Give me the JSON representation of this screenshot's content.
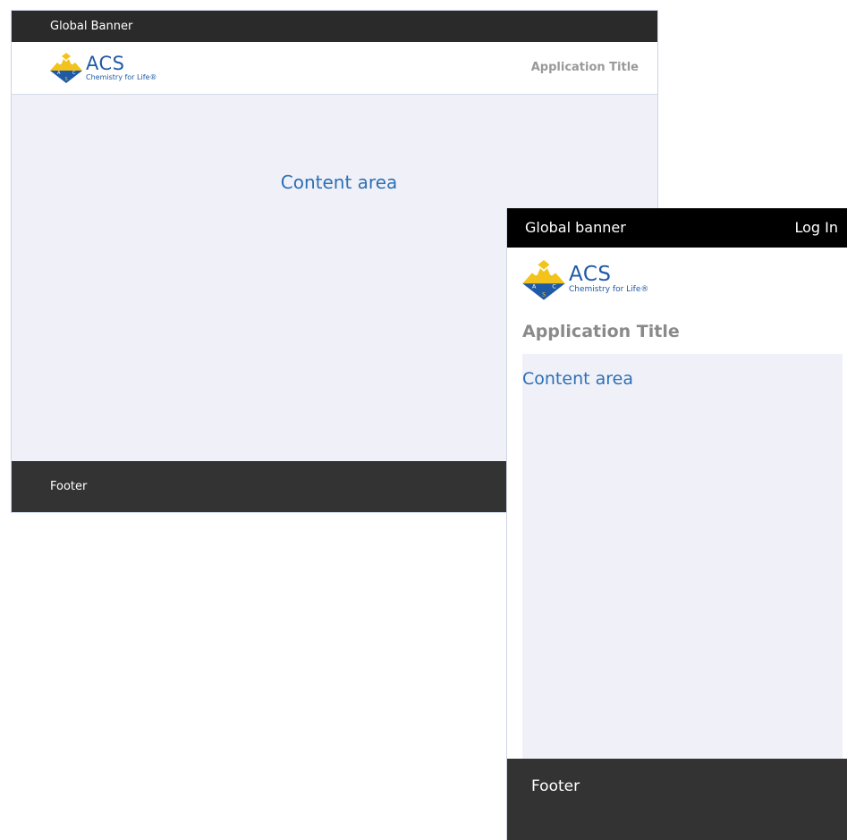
{
  "desktop": {
    "banner": "Global Banner",
    "logo": {
      "acs": "ACS",
      "tagline": "Chemistry for Life®"
    },
    "app_title": "Application Title",
    "content": "Content area",
    "footer": "Footer"
  },
  "mobile": {
    "banner": "Global banner",
    "login": "Log In",
    "logo": {
      "acs": "ACS",
      "tagline": "Chemistry for Life®"
    },
    "app_title": "Application Title",
    "content": "Content area",
    "footer": "Footer"
  },
  "colors": {
    "brand_blue": "#1f5aa6",
    "logo_gold": "#f3c31c",
    "content_text": "#2d6fb5",
    "banner_bg": "#2a2a2a",
    "footer_bg": "#333333",
    "content_bg": "#f0f1f8"
  },
  "icons": {
    "logo": "acs-eagle-diamond-icon"
  }
}
